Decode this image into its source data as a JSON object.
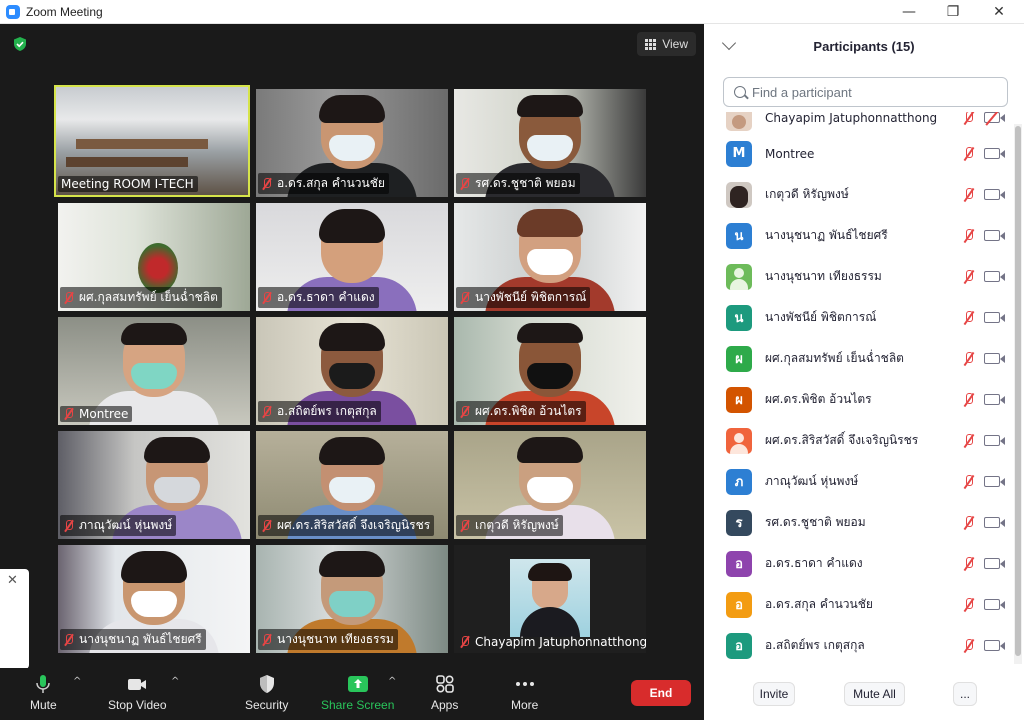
{
  "window": {
    "title": "Zoom Meeting",
    "minimize": "—",
    "maximize": "❐",
    "close": "✕"
  },
  "stage": {
    "view_label": "View",
    "tiles": [
      {
        "name": "Meeting ROOM I-TECH",
        "muted": false
      },
      {
        "name": "อ.ดร.สกุล  คำนวนชัย",
        "muted": true
      },
      {
        "name": "รศ.ดร.ชูชาติ  พยอม",
        "muted": true
      },
      {
        "name": "ผศ.กุลสมทรัพย์  เย็นฉ่ำชลิต",
        "muted": true
      },
      {
        "name": "อ.ดร.ธาดา  คำแดง",
        "muted": true
      },
      {
        "name": "นางพัชนีย์  พิชิตการณ์",
        "muted": true
      },
      {
        "name": "Montree",
        "muted": true
      },
      {
        "name": "อ.สถิตย์พร  เกตุสกุล",
        "muted": true
      },
      {
        "name": "ผศ.ดร.พิชิต  อ้วนไตร",
        "muted": true
      },
      {
        "name": "ภาณุวัฒน์  หุ่นพงษ์",
        "muted": true
      },
      {
        "name": "ผศ.ดร.สิริสวัสดิ์ จึงเจริญนิรชร",
        "muted": true
      },
      {
        "name": "เกตุวดี หิรัญพงษ์",
        "muted": true
      },
      {
        "name": "นางนุชนาฏ  พันธ์ไชยศรี",
        "muted": true
      },
      {
        "name": "นางนุชนาท  เทียงธรรม",
        "muted": true
      },
      {
        "name": "Chayapim Jatuphonnatthong",
        "muted": true
      }
    ]
  },
  "toolbar": {
    "mute": "Mute",
    "stop_video": "Stop Video",
    "security": "Security",
    "share_screen": "Share Screen",
    "apps": "Apps",
    "more": "More",
    "end": "End"
  },
  "panel": {
    "title": "Participants (15)",
    "search_placeholder": "Find a participant",
    "participants": [
      {
        "name": "Chayapim Jatuphonnatthong",
        "initial": "",
        "color": "#d9c7b8",
        "video_off": true
      },
      {
        "name": "Montree",
        "initial": "M",
        "color": "#2d7fd3",
        "video_off": false
      },
      {
        "name": "เกตุวดี หิรัญพงษ์",
        "initial": "",
        "color": "#3b3030",
        "video_off": false
      },
      {
        "name": "นางนุชนาฏ  พันธ์ไชยศรี",
        "initial": "น",
        "color": "#2d7fd3",
        "video_off": false
      },
      {
        "name": "นางนุชนาท  เทียงธรรม",
        "initial": "",
        "color": "#4caf50",
        "video_off": false
      },
      {
        "name": "นางพัชนีย์  พิชิตการณ์",
        "initial": "น",
        "color": "#1d9a7e",
        "video_off": false
      },
      {
        "name": "ผศ.กุลสมทรัพย์  เย็นฉ่ำชลิต",
        "initial": "ผ",
        "color": "#2eaa4a",
        "video_off": false
      },
      {
        "name": "ผศ.ดร.พิชิต  อ้วนไตร",
        "initial": "ผ",
        "color": "#d35400",
        "video_off": false
      },
      {
        "name": "ผศ.ดร.สิริสวัสดิ์ จึงเจริญนิรชร",
        "initial": "",
        "color": "#f0643c",
        "video_off": false
      },
      {
        "name": "ภาณุวัฒน์  หุ่นพงษ์",
        "initial": "ภ",
        "color": "#2d7fd3",
        "video_off": false
      },
      {
        "name": "รศ.ดร.ชูชาติ  พยอม",
        "initial": "ร",
        "color": "#34495e",
        "video_off": false
      },
      {
        "name": "อ.ดร.ธาดา  คำแดง",
        "initial": "อ",
        "color": "#8e44ad",
        "video_off": false
      },
      {
        "name": "อ.ดร.สกุล  คำนวนชัย",
        "initial": "อ",
        "color": "#f39c12",
        "video_off": false
      },
      {
        "name": "อ.สถิตย์พร  เกตุสกุล",
        "initial": "อ",
        "color": "#1d9a7e",
        "video_off": false
      }
    ],
    "invite": "Invite",
    "mute_all": "Mute All",
    "more": "..."
  },
  "colors": {
    "active_speaker": "#d6e44a",
    "end": "#d82c2c",
    "share": "#29c55b",
    "muted": "#e64545"
  }
}
